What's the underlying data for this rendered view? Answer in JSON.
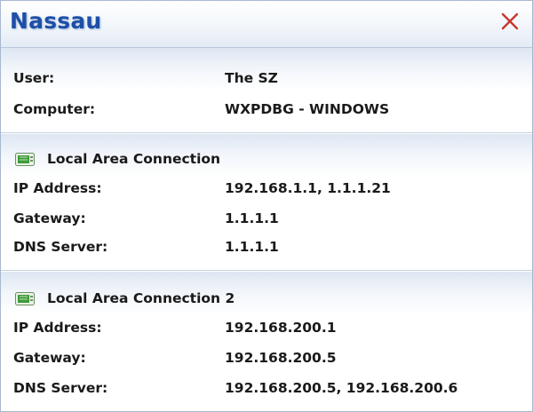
{
  "window": {
    "title": "Nassau",
    "close_icon": "close-icon"
  },
  "user_info": {
    "user_label": "User:",
    "user_value": "The SZ",
    "computer_label": "Computer:",
    "computer_value": "WXPDBG - WINDOWS"
  },
  "connections": [
    {
      "name": "Local Area Connection",
      "icon": "network-adapter-icon",
      "ip_label": "IP Address:",
      "ip_value": "192.168.1.1, 1.1.1.21",
      "gateway_label": "Gateway:",
      "gateway_value": "1.1.1.1",
      "dns_label": "DNS Server:",
      "dns_value": "1.1.1.1"
    },
    {
      "name": "Local Area Connection 2",
      "icon": "network-adapter-icon",
      "ip_label": "IP Address:",
      "ip_value": "192.168.200.1",
      "gateway_label": "Gateway:",
      "gateway_value": "192.168.200.5",
      "dns_label": "DNS Server:",
      "dns_value": "192.168.200.5, 192.168.200.6"
    }
  ],
  "colors": {
    "title": "#1d4fa7",
    "close": "#c0392b",
    "icon_green": "#3f9a3a"
  }
}
